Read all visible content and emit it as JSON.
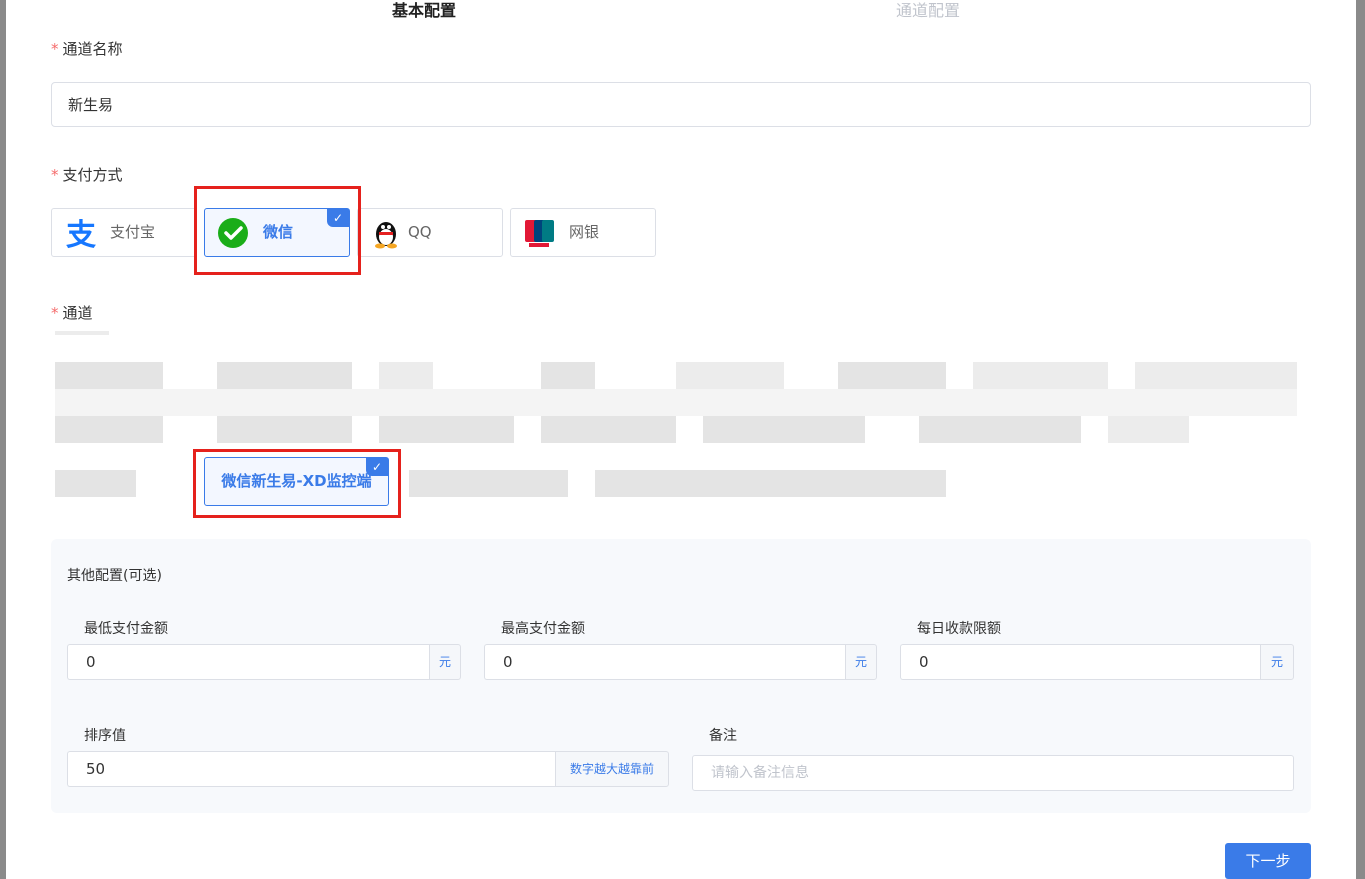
{
  "steps": [
    "基本配置",
    "通道配置"
  ],
  "channel_name": {
    "label": "通道名称",
    "value": "新生易"
  },
  "pay_method": {
    "label": "支付方式",
    "options": [
      {
        "label": "支付宝",
        "icon": "alipay-icon"
      },
      {
        "label": "微信",
        "icon": "wechat-icon",
        "selected": true
      },
      {
        "label": "QQ",
        "icon": "qq-icon"
      },
      {
        "label": "网银",
        "icon": "unionpay-icon"
      }
    ],
    "check": "✓"
  },
  "channel": {
    "label": "通道",
    "selected_option": "微信新生易-XD监控端",
    "check": "✓"
  },
  "other_config": {
    "title": "其他配置(可选)",
    "min_amount": {
      "label": "最低支付金额",
      "value": "0",
      "unit": "元"
    },
    "max_amount": {
      "label": "最高支付金额",
      "value": "0",
      "unit": "元"
    },
    "daily_limit": {
      "label": "每日收款限额",
      "value": "0",
      "unit": "元"
    },
    "sort": {
      "label": "排序值",
      "value": "50",
      "hint": "数字越大越靠前"
    },
    "remark": {
      "label": "备注",
      "placeholder": "请输入备注信息"
    }
  },
  "next_button": "下一步",
  "colors": {
    "primary": "#3a7be8",
    "required": "#f56c6c",
    "highlight": "#e5211c"
  }
}
